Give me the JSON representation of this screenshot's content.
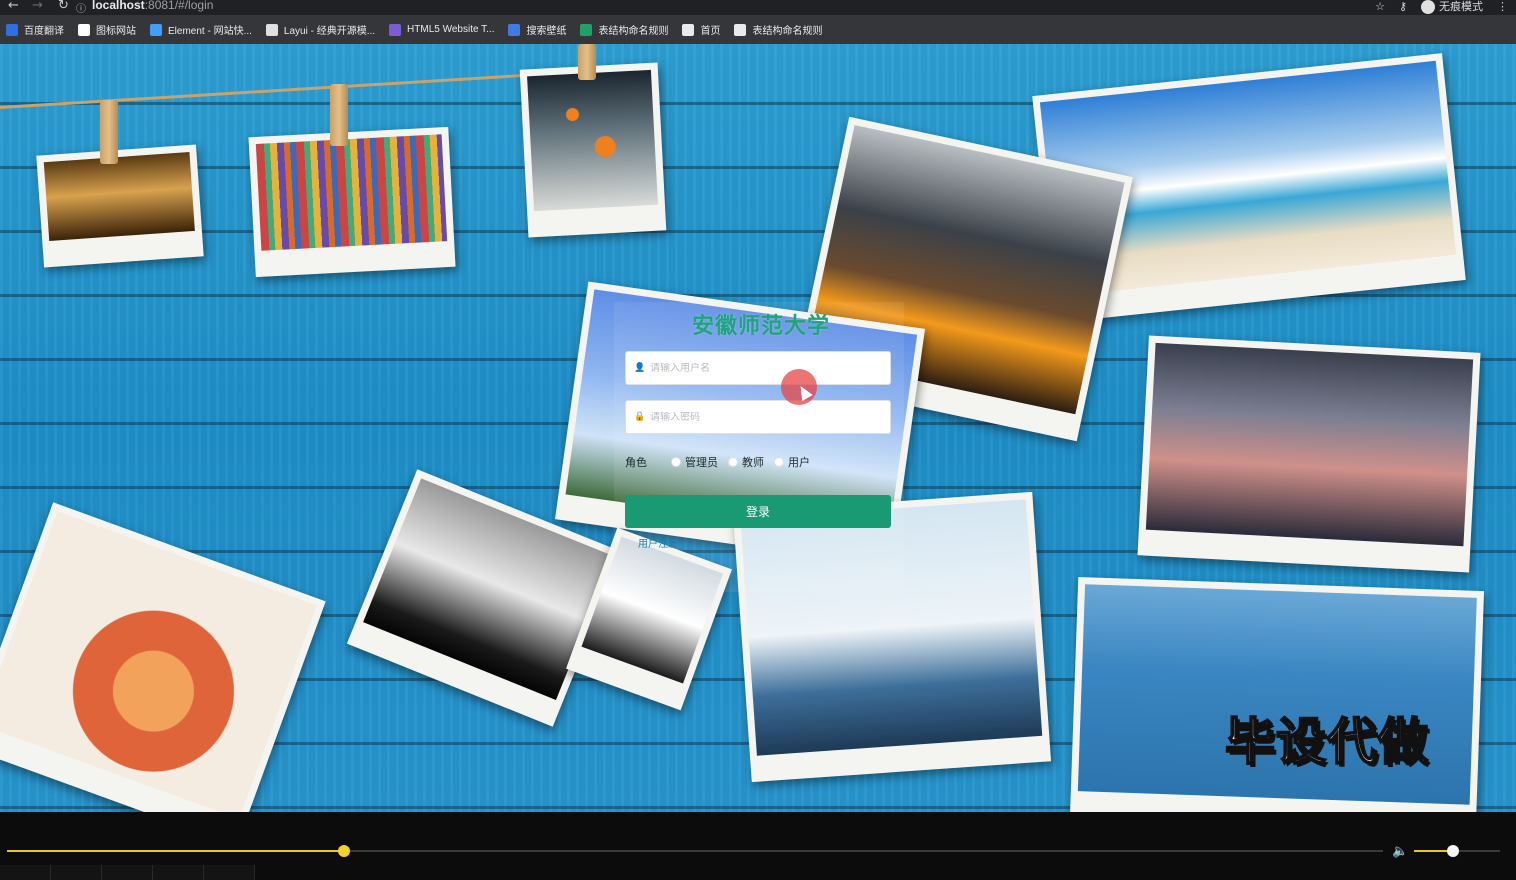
{
  "browser": {
    "url_host": "localhost",
    "url_rest": ":8081/#/login",
    "incognito_label": "无痕模式",
    "bookmarks": [
      {
        "label": "百度翻译",
        "color": "#2f6fe0"
      },
      {
        "label": "图标网站",
        "color": "#ffffff"
      },
      {
        "label": "Element - 网站快...",
        "color": "#409eff"
      },
      {
        "label": "Layui - 经典开源模...",
        "color": "#e0e0e0"
      },
      {
        "label": "HTML5 Website T...",
        "color": "#7b5cd6"
      },
      {
        "label": "搜索壁纸",
        "color": "#3e7be6"
      },
      {
        "label": "表结构命名规则",
        "color": "#22a06b"
      },
      {
        "label": "首页",
        "color": "#e8eaed"
      },
      {
        "label": "表结构命名规则",
        "color": "#e8eaed"
      }
    ]
  },
  "login": {
    "title": "安徽师范大学",
    "username_placeholder": "请输入用户名",
    "password_placeholder": "请输入密码",
    "role_label": "角色",
    "roles": [
      "管理员",
      "教师",
      "用户"
    ],
    "submit_label": "登录",
    "register_link": "用户注册"
  },
  "watermark": "毕设代做",
  "player": {
    "progress": 0.245,
    "volume": 0.45
  },
  "colors": {
    "accent": "#1a9a72",
    "title": "#1ea57d",
    "seek": "#e6c42a"
  }
}
